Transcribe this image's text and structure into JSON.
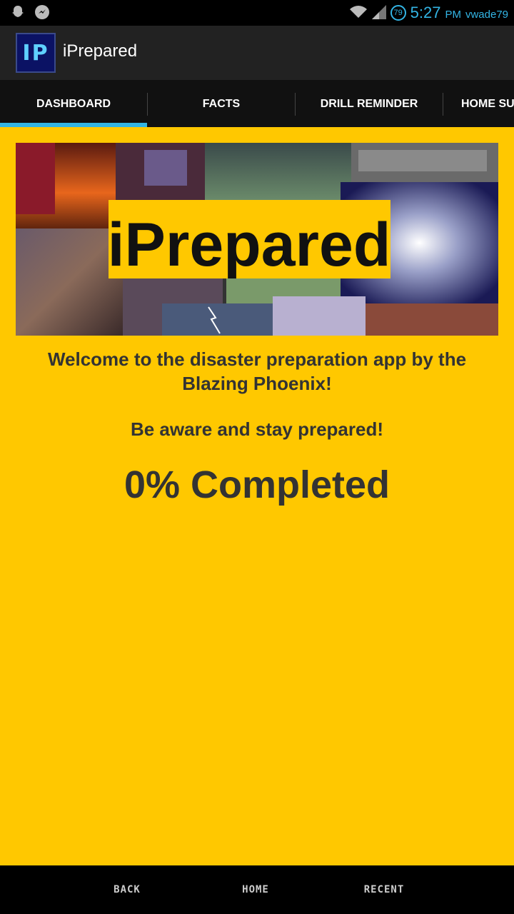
{
  "status_bar": {
    "time": "5:27",
    "ampm": "PM",
    "user": "vwade79",
    "battery": "79",
    "icons": [
      "snapchat-icon",
      "messenger-icon",
      "wifi-icon",
      "signal-icon"
    ],
    "accent": "#33b5e5"
  },
  "action_bar": {
    "app_icon_text": "IP",
    "title": "iPrepared"
  },
  "tabs": [
    {
      "label": "DASHBOARD",
      "selected": true
    },
    {
      "label": "FACTS",
      "selected": false
    },
    {
      "label": "DRILL REMINDER",
      "selected": false
    },
    {
      "label": "HOME SU",
      "selected": false
    }
  ],
  "banner": {
    "title": "iPrepared"
  },
  "main": {
    "welcome": "Welcome to the disaster preparation app by the Blazing Phoenix!",
    "aware": "Be aware and stay prepared!",
    "progress": "0% Completed",
    "background": "#ffc800"
  },
  "nav_bar": {
    "back": "BACK",
    "home": "HOME",
    "recent": "RECENT"
  }
}
